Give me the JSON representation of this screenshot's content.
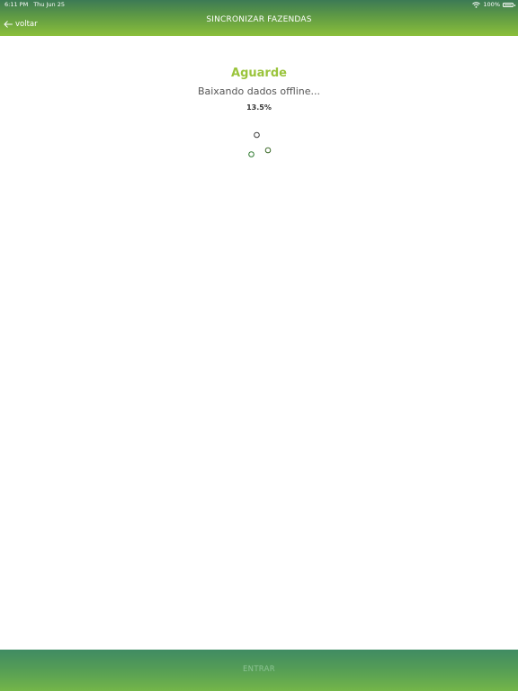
{
  "status_bar": {
    "time": "6:11 PM",
    "date": "Thu Jun 25",
    "battery": "100%"
  },
  "header": {
    "back_label": "voltar",
    "title": "SINCRONIZAR FAZENDAS"
  },
  "main": {
    "title": "Aguarde",
    "subtitle": "Baixando dados offline...",
    "progress_text": "13.5%"
  },
  "footer": {
    "button_label": "ENTRAR"
  },
  "icons": {
    "back": "arrow-left-icon",
    "wifi": "wifi-icon",
    "battery": "battery-icon",
    "spinner": "loading-spinner-icon"
  },
  "colors": {
    "header_top": "#3c7a55",
    "header_bottom": "#8bbf3a",
    "title": "#9ac43c",
    "spinner_stroke": "#3d6b2a",
    "footer_top": "#3f8b63",
    "footer_bottom": "#74b649",
    "footer_text": "#8cc394"
  }
}
